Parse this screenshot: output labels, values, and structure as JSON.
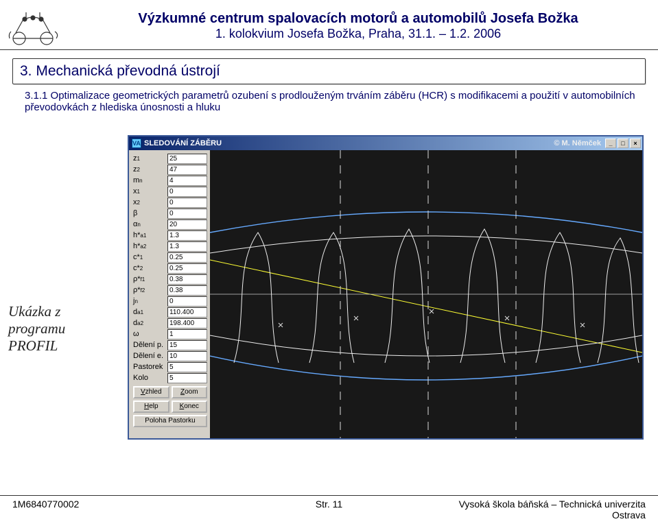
{
  "header": {
    "title_line1": "Výzkumné centrum spalovacích motorů a automobilů Josefa Božka",
    "title_line2": "1. kolokvium Josefa Božka, Praha, 31.1. – 1.2. 2006"
  },
  "section": {
    "title": "3. Mechanická převodná ústrojí",
    "subtitle": "3.1.1 Optimalizace geometrických parametrů ozubení s prodlouženým trváním záběru (HCR) s modifikacemi a použití v automobilních převodovkách z hlediska únosnosti a hluku"
  },
  "caption": {
    "line1": "Ukázka z programu",
    "line2": "PROFIL"
  },
  "app": {
    "titlebar": {
      "icon_glyph": "VA",
      "title": "SLEDOVÁNÍ ZÁBĚRU",
      "author": "© M. Němček",
      "minimize": "_",
      "maximize": "□",
      "close": "×"
    },
    "params": [
      {
        "label_html": "z<sub>1</sub>",
        "value": "25"
      },
      {
        "label_html": "z<sub>2</sub>",
        "value": "47"
      },
      {
        "label_html": "m<sub>n</sub>",
        "value": "4"
      },
      {
        "label_html": "x<sub>1</sub>",
        "value": "0"
      },
      {
        "label_html": "x<sub>2</sub>",
        "value": "0"
      },
      {
        "label_html": "β",
        "value": "0"
      },
      {
        "label_html": "α<sub>n</sub>",
        "value": "20"
      },
      {
        "label_html": "h*<sub>a1</sub>",
        "value": "1.3"
      },
      {
        "label_html": "h*<sub>a2</sub>",
        "value": "1.3"
      },
      {
        "label_html": "c*<sub>1</sub>",
        "value": "0.25"
      },
      {
        "label_html": "c*<sub>2</sub>",
        "value": "0.25"
      },
      {
        "label_html": "ρ*<sub>f1</sub>",
        "value": "0.38"
      },
      {
        "label_html": "ρ*<sub>f2</sub>",
        "value": "0.38"
      },
      {
        "label_html": "j<sub>n</sub>",
        "value": "0"
      },
      {
        "label_html": "d<sub>a1</sub>",
        "value": "110.400"
      },
      {
        "label_html": "d<sub>a2</sub>",
        "value": "198.400"
      },
      {
        "label_html": "ω",
        "value": "1"
      },
      {
        "label_html": "Dělení p.",
        "value": "15"
      },
      {
        "label_html": "Dělení e.",
        "value": "10"
      },
      {
        "label_html": "Pastorek",
        "value": "5"
      },
      {
        "label_html": "Kolo",
        "value": "5"
      }
    ],
    "buttons": {
      "vzhled": "Vzhled",
      "zoom": "Zoom",
      "help": "Help",
      "konec": "Konec",
      "poloha": "Poloha Pastorku"
    }
  },
  "footer": {
    "left": "1M6840770002",
    "center": "Str. 11",
    "right": "Vysoká škola báňská – Technická univerzita Ostrava"
  }
}
